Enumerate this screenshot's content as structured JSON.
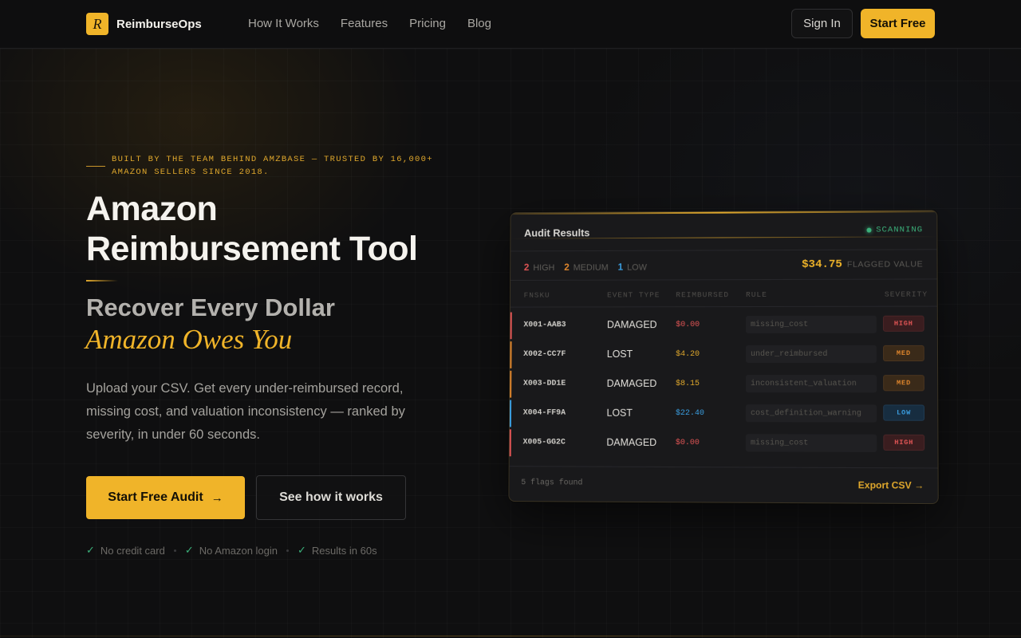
{
  "brand": {
    "logo_letter": "R",
    "name": "ReimburseOps",
    "accent": "#f0b429"
  },
  "nav": {
    "links": [
      "How It Works",
      "Features",
      "Pricing",
      "Blog"
    ],
    "sign_in": "Sign In",
    "start_free": "Start Free"
  },
  "hero": {
    "eyebrow": "BUILT BY THE TEAM BEHIND AMZBASE — TRUSTED BY 16,000+ AMAZON SELLERS SINCE 2018.",
    "title_line1": "Amazon",
    "title_line2": "Reimbursement Tool",
    "subtitle_line1": "Recover Every Dollar",
    "subtitle_line2": "Amazon Owes You",
    "description": "Upload your CSV. Get every under-reimbursed record, missing cost, and valuation inconsistency — ranked by severity, in under 60 seconds.",
    "cta_primary": "Start Free Audit",
    "cta_primary_icon": "arrow-right-icon",
    "cta_secondary": "See how it works",
    "trust": [
      "No credit card",
      "No Amazon login",
      "Results in 60s"
    ]
  },
  "panel": {
    "title": "Audit Results",
    "status": "SCANNING",
    "counts": [
      {
        "n": "2",
        "label": "HIGH",
        "color": "#e25555"
      },
      {
        "n": "2",
        "label": "MEDIUM",
        "color": "#e0862c"
      },
      {
        "n": "1",
        "label": "LOW",
        "color": "#3a9ee0"
      }
    ],
    "flagged_value": "$34.75",
    "flagged_label": "FLAGGED VALUE",
    "columns": [
      "FNSKU",
      "EVENT TYPE",
      "REIMBURSED",
      "RULE",
      "SEVERITY"
    ],
    "rows": [
      {
        "fnsku": "X001-AAB3",
        "event": "DAMAGED",
        "reimbursed": "$0.00",
        "rule": "missing_cost",
        "severity": "HIGH"
      },
      {
        "fnsku": "X002-CC7F",
        "event": "LOST",
        "reimbursed": "$4.20",
        "rule": "under_reimbursed",
        "severity": "MED"
      },
      {
        "fnsku": "X003-DD1E",
        "event": "DAMAGED",
        "reimbursed": "$8.15",
        "rule": "inconsistent_valuation",
        "severity": "MED"
      },
      {
        "fnsku": "X004-FF9A",
        "event": "LOST",
        "reimbursed": "$22.40",
        "rule": "cost_definition_warning",
        "severity": "LOW"
      },
      {
        "fnsku": "X005-GG2C",
        "event": "DAMAGED",
        "reimbursed": "$0.00",
        "rule": "missing_cost",
        "severity": "HIGH"
      }
    ],
    "footer_count": "5 flags found",
    "export_label": "Export CSV →"
  }
}
